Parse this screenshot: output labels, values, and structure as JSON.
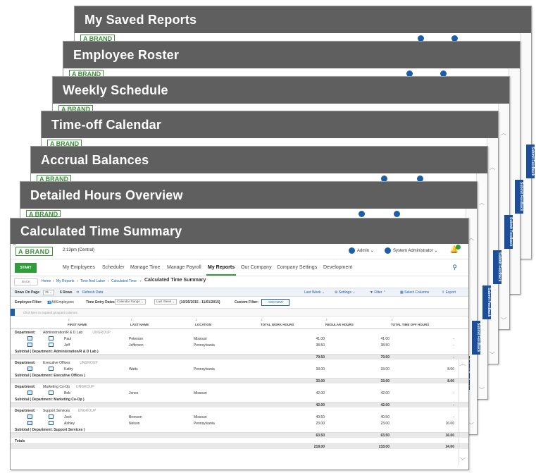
{
  "stack_titles": [
    "My Saved Reports",
    "Employee Roster",
    "Weekly Schedule",
    "Time-off Calendar",
    "Accrual Balances",
    "Detailed Hours Overview",
    "Calculated Time Summary"
  ],
  "vertical_tab_label": "Submit Feedback",
  "app": {
    "brand": "A BRAND",
    "clock": "2:13pm (Central)",
    "user_admin": "Admin",
    "user_sysadmin": "System Administrator",
    "start_label": "START",
    "nav": [
      "My Employees",
      "Scheduler",
      "Manage Time",
      "Manage Payroll",
      "My Reports",
      "Our Company",
      "Company Settings",
      "Development"
    ],
    "nav_active": "My Reports",
    "back_label": "BACK",
    "breadcrumbs": [
      "Home",
      "My Reports",
      "Time And Labor",
      "Calculated Time"
    ],
    "page_title": "Calculated Time Summary"
  },
  "toolbar": {
    "rows_on_page_label": "Rows On Page",
    "rows_on_page_value": "25",
    "rows_count": "6 Rows",
    "refresh": "Refresh Data",
    "last_week": "Last Week",
    "settings": "Settings",
    "filter": "Filter",
    "select_columns": "Select Columns",
    "export": "Export"
  },
  "filters": {
    "employee_filter_label": "Employee Filter:",
    "employee_filter_value": "All Employees",
    "time_entry_label": "Time Entry Dates:",
    "calendar_range": "Calendar Range",
    "last_week": "Last Week",
    "date_range": "(10/26/2015 - 11/01/2015)",
    "custom_filter_label": "Custom Filter:",
    "add_new": "ADD NEW",
    "group_hint": "Click here to expand grouped columns"
  },
  "columns": [
    "FIRST NAME",
    "LAST NAME",
    "LOCATION",
    "TOTAL WORK HOURS",
    "REGULAR HOURS",
    "TOTAL TIME OFF HOURS"
  ],
  "groups": [
    {
      "dept": "Administration/R & D Lab",
      "rows": [
        {
          "first": "Paul",
          "last": "Peterson",
          "loc": "Missouri",
          "work": "41.00",
          "reg": "41.00",
          "off": "-"
        },
        {
          "first": "Jeff",
          "last": "Jefferson",
          "loc": "Pennsylvania",
          "work": "38.50",
          "reg": "38.50",
          "off": "-"
        }
      ],
      "subtotal_label": "Subtotal ( Department: Administration/R & D Lab )",
      "sub_work": "79.50",
      "sub_reg": "79.50",
      "sub_off": "-"
    },
    {
      "dept": "Executive Offices",
      "rows": [
        {
          "first": "Kathy",
          "last": "Watts",
          "loc": "Pennsylvania",
          "work": "33.00",
          "reg": "33.00",
          "off": "8.00"
        }
      ],
      "subtotal_label": "Subtotal ( Department: Executive Offices )",
      "sub_work": "33.00",
      "sub_reg": "33.00",
      "sub_off": "8.00"
    },
    {
      "dept": "Marketing Co-Op",
      "rows": [
        {
          "first": "Bob",
          "last": "Jones",
          "loc": "Missouri",
          "work": "42.00",
          "reg": "42.00",
          "off": "-"
        }
      ],
      "subtotal_label": "Subtotal ( Department: Marketing Co-Op )",
      "sub_work": "42.00",
      "sub_reg": "42.00",
      "sub_off": "-"
    },
    {
      "dept": "Support Services",
      "rows": [
        {
          "first": "Josh",
          "last": "Bronson",
          "loc": "Missouri",
          "work": "40.50",
          "reg": "40.50",
          "off": "-"
        },
        {
          "first": "Ashley",
          "last": "Nelson",
          "loc": "Pennsylvania",
          "work": "23.00",
          "reg": "23.00",
          "off": "16.00"
        }
      ],
      "subtotal_label": "Subtotal ( Department: Support Services )",
      "sub_work": "63.50",
      "sub_reg": "63.50",
      "sub_off": "16.00"
    }
  ],
  "dept_prefix": "Department:",
  "ungroup_label": "UNGROUP",
  "totals": {
    "label": "Totals",
    "work": "218.00",
    "reg": "218.00",
    "off": "24.00"
  }
}
